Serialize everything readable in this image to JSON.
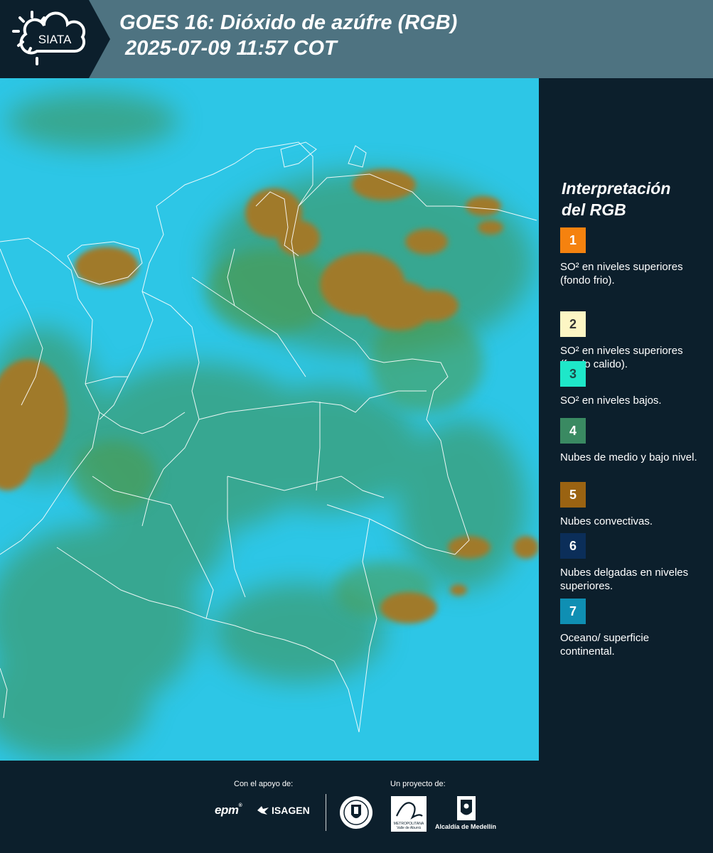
{
  "header": {
    "logo_text": "SIATA",
    "title_line1": "GOES 16: Dióxido de azúfre (RGB)",
    "title_line2": " 2025-07-09 11:57 COT"
  },
  "legend": {
    "title_line1": "Interpretación",
    "title_line2": "del RGB",
    "items": [
      {
        "number": "1",
        "color": "#f5820f",
        "text_color": "#ffffff",
        "description": "SO² en niveles superiores (fondo frio)."
      },
      {
        "number": "2",
        "color": "#fdf6c4",
        "text_color": "#333333",
        "description": "SO² en niveles superiores (fondo calido)."
      },
      {
        "number": "3",
        "color": "#1ee7c9",
        "text_color": "#1d4b47",
        "description": "SO² en niveles bajos."
      },
      {
        "number": "4",
        "color": "#3a8a62",
        "text_color": "#ffffff",
        "description": "Nubes de medio y bajo nivel."
      },
      {
        "number": "5",
        "color": "#9a6312",
        "text_color": "#ffffff",
        "description": "Nubes convectivas."
      },
      {
        "number": "6",
        "color": "#0b2e59",
        "text_color": "#ffffff",
        "description": "Nubes delgadas en niveles superiores."
      },
      {
        "number": "7",
        "color": "#0f8fb3",
        "text_color": "#ffffff",
        "description": "Oceano/ superficie continental."
      }
    ]
  },
  "footer": {
    "support_label": "Con el apoyo de:",
    "project_label": "Un proyecto de:",
    "sponsor1": "epm",
    "sponsor2": "ISAGEN",
    "partner_area_line1": "METROPOLITANA",
    "partner_area_line2": "Valle de Aburrá",
    "partner_alcaldia": "Alcaldía de Medellín"
  },
  "colors": {
    "header_bg": "#4e7381",
    "panel_bg": "#0c1f2c",
    "map_ocean": "#2dc6e6",
    "map_green": "#3f8f4e",
    "map_convective": "#a07a2c"
  }
}
